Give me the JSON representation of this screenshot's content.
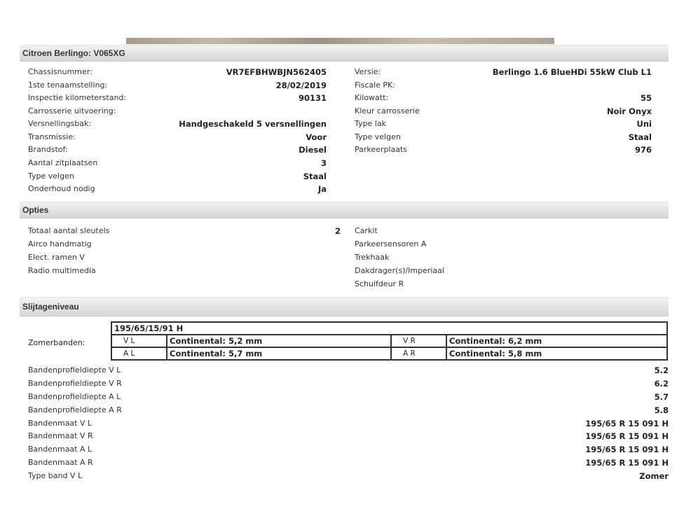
{
  "title": "Citroen Berlingo: V065XG",
  "vehicle_left": [
    {
      "label": "Chassisnummer:",
      "value": "VR7EFBHWBJN562405"
    },
    {
      "label": "1ste tenaamstelling:",
      "value": "28/02/2019"
    },
    {
      "label": "Inspectie kilometerstand:",
      "value": "90131"
    },
    {
      "label": "Carrosserie uitvoering:",
      "value": ""
    },
    {
      "label": "Versnellingsbak:",
      "value": "Handgeschakeld 5 versnellingen"
    },
    {
      "label": "Transmissie:",
      "value": "Voor"
    },
    {
      "label": "Brandstof:",
      "value": "Diesel"
    },
    {
      "label": "Aantal zitplaatsen",
      "value": "3"
    },
    {
      "label": "Type velgen",
      "value": "Staal"
    },
    {
      "label": "Onderhoud nodig",
      "value": "Ja"
    }
  ],
  "vehicle_right": [
    {
      "label": "Versie:",
      "value": "Berlingo 1.6 BlueHDi 55kW Club L1"
    },
    {
      "label": "Fiscale PK:",
      "value": ""
    },
    {
      "label": "Kilowatt:",
      "value": "55"
    },
    {
      "label": "Kleur carrosserie",
      "value": "Noir Onyx"
    },
    {
      "label": "Type lak",
      "value": "Uni"
    },
    {
      "label": "Type velgen",
      "value": "Staal"
    },
    {
      "label": "Parkeerplaats",
      "value": "976"
    }
  ],
  "options_title": "Opties",
  "options_left": [
    {
      "label": "Totaal aantal sleutels",
      "value": "2"
    },
    {
      "label": "Airco handmatig",
      "value": ""
    },
    {
      "label": "Elect. ramen V",
      "value": ""
    },
    {
      "label": "Radio multimedia",
      "value": ""
    }
  ],
  "options_right": [
    "Carkit",
    "Parkeersensoren A",
    "Trekhaak",
    "Dakdrager(s)/Imperiaal",
    "Schuifdeur R"
  ],
  "wear_title": "Slijtageniveau",
  "tyres": {
    "label": "Zomerbanden:",
    "size": "195/65/15/91 H",
    "vl_pos": "V L",
    "vl": "Continental: 5,2 mm",
    "vr_pos": "V R",
    "vr": "Continental: 6,2 mm",
    "al_pos": "A L",
    "al": "Continental: 5,7 mm",
    "ar_pos": "A R",
    "ar": "Continental: 5,8 mm"
  },
  "wear_rows": [
    {
      "label": "Bandenprofieldiepte V L",
      "value": "5.2"
    },
    {
      "label": "Bandenprofieldiepte V R",
      "value": "6.2"
    },
    {
      "label": "Bandenprofieldiepte A L",
      "value": "5.7"
    },
    {
      "label": "Bandenprofieldiepte A R",
      "value": "5.8"
    },
    {
      "label": "Bandenmaat V L",
      "value": "195/65 R 15 091 H"
    },
    {
      "label": "Bandenmaat V R",
      "value": "195/65 R 15 091 H"
    },
    {
      "label": "Bandenmaat A L",
      "value": "195/65 R 15 091 H"
    },
    {
      "label": "Bandenmaat A R",
      "value": "195/65 R 15 091 H"
    },
    {
      "label": "Type band V L",
      "value": "Zomer"
    }
  ]
}
